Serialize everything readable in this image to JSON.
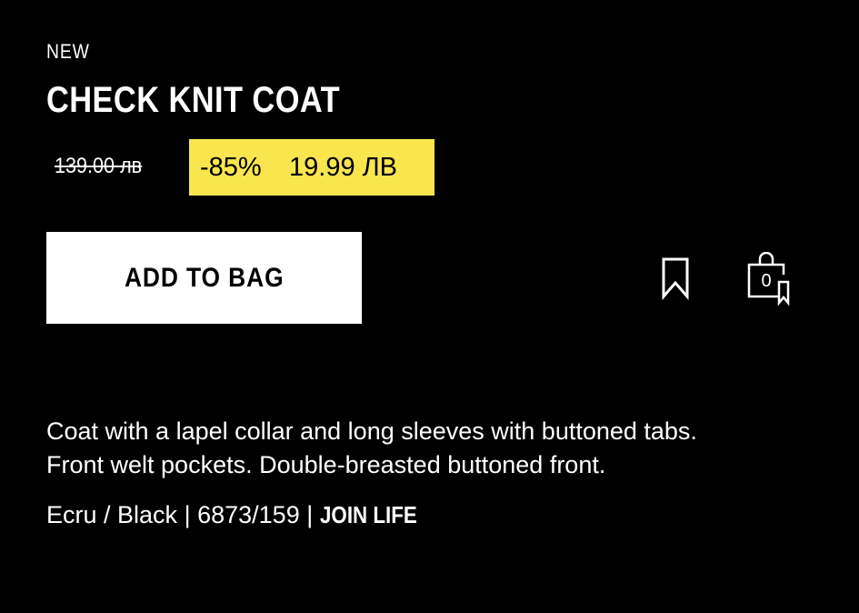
{
  "product": {
    "badge": "NEW",
    "name": "CHECK KNIT COAT",
    "old_price": "139.00 лв",
    "discount": "-85%",
    "sale_price": "19.99 ЛВ",
    "add_to_bag_label": "ADD TO BAG",
    "bag_count": "0",
    "description_line1": "Coat with a lapel collar and long sleeves with buttoned tabs.",
    "description_line2": "Front welt pockets. Double-breasted buttoned front.",
    "color": "Ecru / Black",
    "separator": "|",
    "reference": "6873/159",
    "join_life": "JOIN LIFE"
  },
  "icons": {
    "bookmark": "bookmark-icon",
    "bag": "shopping-bag-icon"
  },
  "colors": {
    "background": "#000000",
    "text": "#ffffff",
    "sale_highlight": "#f9e64f",
    "button_bg": "#ffffff",
    "button_text": "#000000"
  }
}
